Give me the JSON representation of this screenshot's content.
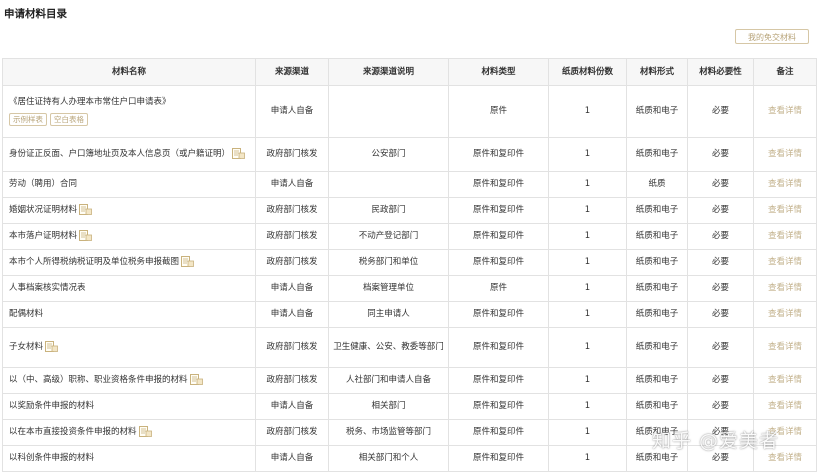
{
  "page": {
    "title": "申请材料目录",
    "my_materials_label": "我的免交材料",
    "watermark": "知乎 @爱美者"
  },
  "table": {
    "headers": [
      "材料名称",
      "来源渠道",
      "来源渠道说明",
      "材料类型",
      "纸质材料份数",
      "材料形式",
      "材料必要性",
      "备注"
    ],
    "sample_form_label": "示例样表",
    "blank_form_label": "空白表格",
    "rows": [
      {
        "name": "《居住证持有人办理本市常住户口申请表》",
        "channel": "申请人自备",
        "channel_desc": "",
        "type": "原件",
        "copies": "1",
        "form": "纸质和电子",
        "necessity": "必要",
        "note": "查看详情"
      },
      {
        "name": "身份证正反面、户口簿地址页及本人信息页（或户籍证明）",
        "channel": "政府部门核发",
        "channel_desc": "公安部门",
        "type": "原件和复印件",
        "copies": "1",
        "form": "纸质和电子",
        "necessity": "必要",
        "note": "查看详情"
      },
      {
        "name": "劳动（聘用）合同",
        "channel": "申请人自备",
        "channel_desc": "",
        "type": "原件和复印件",
        "copies": "1",
        "form": "纸质",
        "necessity": "必要",
        "note": "查看详情"
      },
      {
        "name": "婚姻状况证明材料",
        "channel": "政府部门核发",
        "channel_desc": "民政部门",
        "type": "原件和复印件",
        "copies": "1",
        "form": "纸质和电子",
        "necessity": "必要",
        "note": "查看详情"
      },
      {
        "name": "本市落户证明材料",
        "channel": "政府部门核发",
        "channel_desc": "不动产登记部门",
        "type": "原件和复印件",
        "copies": "1",
        "form": "纸质和电子",
        "necessity": "必要",
        "note": "查看详情"
      },
      {
        "name": "本市个人所得税纳税证明及单位税务申报截图",
        "channel": "政府部门核发",
        "channel_desc": "税务部门和单位",
        "type": "原件和复印件",
        "copies": "1",
        "form": "纸质和电子",
        "necessity": "必要",
        "note": "查看详情"
      },
      {
        "name": "人事档案核实情况表",
        "channel": "申请人自备",
        "channel_desc": "档案管理单位",
        "type": "原件",
        "copies": "1",
        "form": "纸质和电子",
        "necessity": "必要",
        "note": "查看详情"
      },
      {
        "name": "配偶材料",
        "channel": "申请人自备",
        "channel_desc": "同主申请人",
        "type": "原件和复印件",
        "copies": "1",
        "form": "纸质和电子",
        "necessity": "必要",
        "note": "查看详情"
      },
      {
        "name": "子女材料",
        "channel": "政府部门核发",
        "channel_desc": "卫生健康、公安、教委等部门",
        "type": "原件和复印件",
        "copies": "1",
        "form": "纸质和电子",
        "necessity": "必要",
        "note": "查看详情"
      },
      {
        "name": "以（中、高级）职称、职业资格条件申报的材料",
        "channel": "政府部门核发",
        "channel_desc": "人社部门和申请人自备",
        "type": "原件和复印件",
        "copies": "1",
        "form": "纸质和电子",
        "necessity": "必要",
        "note": "查看详情"
      },
      {
        "name": "以奖励条件申报的材料",
        "channel": "申请人自备",
        "channel_desc": "相关部门",
        "type": "原件和复印件",
        "copies": "1",
        "form": "纸质和电子",
        "necessity": "必要",
        "note": "查看详情"
      },
      {
        "name": "以在本市直接投资条件申报的材料",
        "channel": "政府部门核发",
        "channel_desc": "税务、市场监管等部门",
        "type": "原件和复印件",
        "copies": "1",
        "form": "纸质和电子",
        "necessity": "必要",
        "note": "查看详情"
      },
      {
        "name": "以科创条件申报的材料",
        "channel": "申请人自备",
        "channel_desc": "相关部门和个人",
        "type": "原件和复印件",
        "copies": "1",
        "form": "纸质和电子",
        "necessity": "必要",
        "note": "查看详情"
      }
    ]
  },
  "icons": {
    "form_attachment": "document-form-icon"
  },
  "colors": {
    "accent": "#c2b08a",
    "border": "#e2e2e2",
    "header_bg": "#f7f7f7"
  }
}
